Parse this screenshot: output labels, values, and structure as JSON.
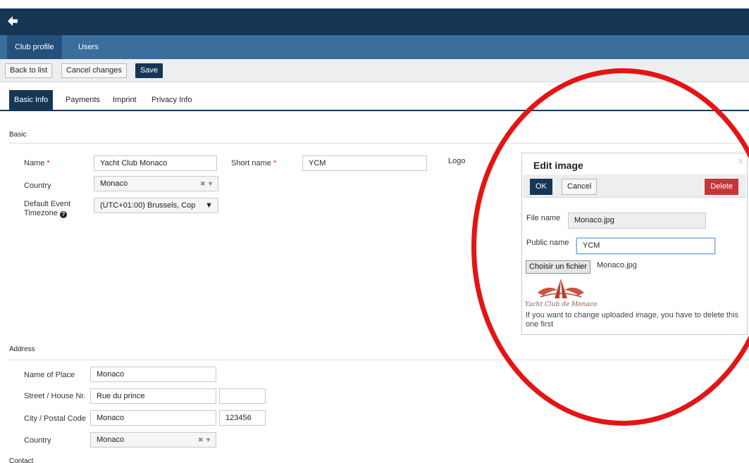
{
  "nav": {
    "tabs": [
      "Club profile",
      "Users"
    ]
  },
  "toolbar": {
    "back": "Back to list",
    "cancel": "Cancel changes",
    "save": "Save"
  },
  "tabs": [
    "Basic Info",
    "Payments",
    "Imprint",
    "Privacy Info"
  ],
  "basic": {
    "section": "Basic",
    "name_label": "Name",
    "name_value": "Yacht Club Monaco",
    "short_label": "Short name",
    "short_value": "YCM",
    "logo_label": "Logo",
    "country_label": "Country",
    "country_value": "Monaco",
    "tz_label_1": "Default Event",
    "tz_label_2": "Timezone",
    "tz_value": "(UTC+01:00) Brussels, Cop",
    "required_mark": "*"
  },
  "address": {
    "section": "Address",
    "place_label": "Name of Place",
    "place_value": "Monaco",
    "street_label": "Street / House Nr.",
    "street_value": "Rue du prince",
    "house_value": "",
    "city_label": "City / Postal Code",
    "city_value": "Monaco",
    "postal_value": "123456",
    "country_label": "Country",
    "country_value": "Monaco"
  },
  "contact": {
    "section": "Contact"
  },
  "edit_image": {
    "title": "Edit image",
    "close": "x",
    "ok": "OK",
    "cancel": "Cancel",
    "delete": "Delete",
    "file_label": "File name",
    "file_value": "Monaco.jpg",
    "public_label": "Public name",
    "public_value": "YCM",
    "choose_button": "Choisir un fichier",
    "chosen_file": "Monaco.jpg",
    "logo_caption": "Yacht Club de Monaco",
    "note": "If you want to change uploaded image, you have to delete this one first"
  },
  "icons": {
    "back": "back-arrow-icon",
    "help": "question-circle-icon",
    "clear": "clear-x-icon",
    "dropdown": "chevron-down-icon"
  },
  "colors": {
    "dark_navy": "#163656",
    "nav_blue": "#3a6e9c",
    "delete_red": "#c73535",
    "annotation_red": "#e51414"
  }
}
